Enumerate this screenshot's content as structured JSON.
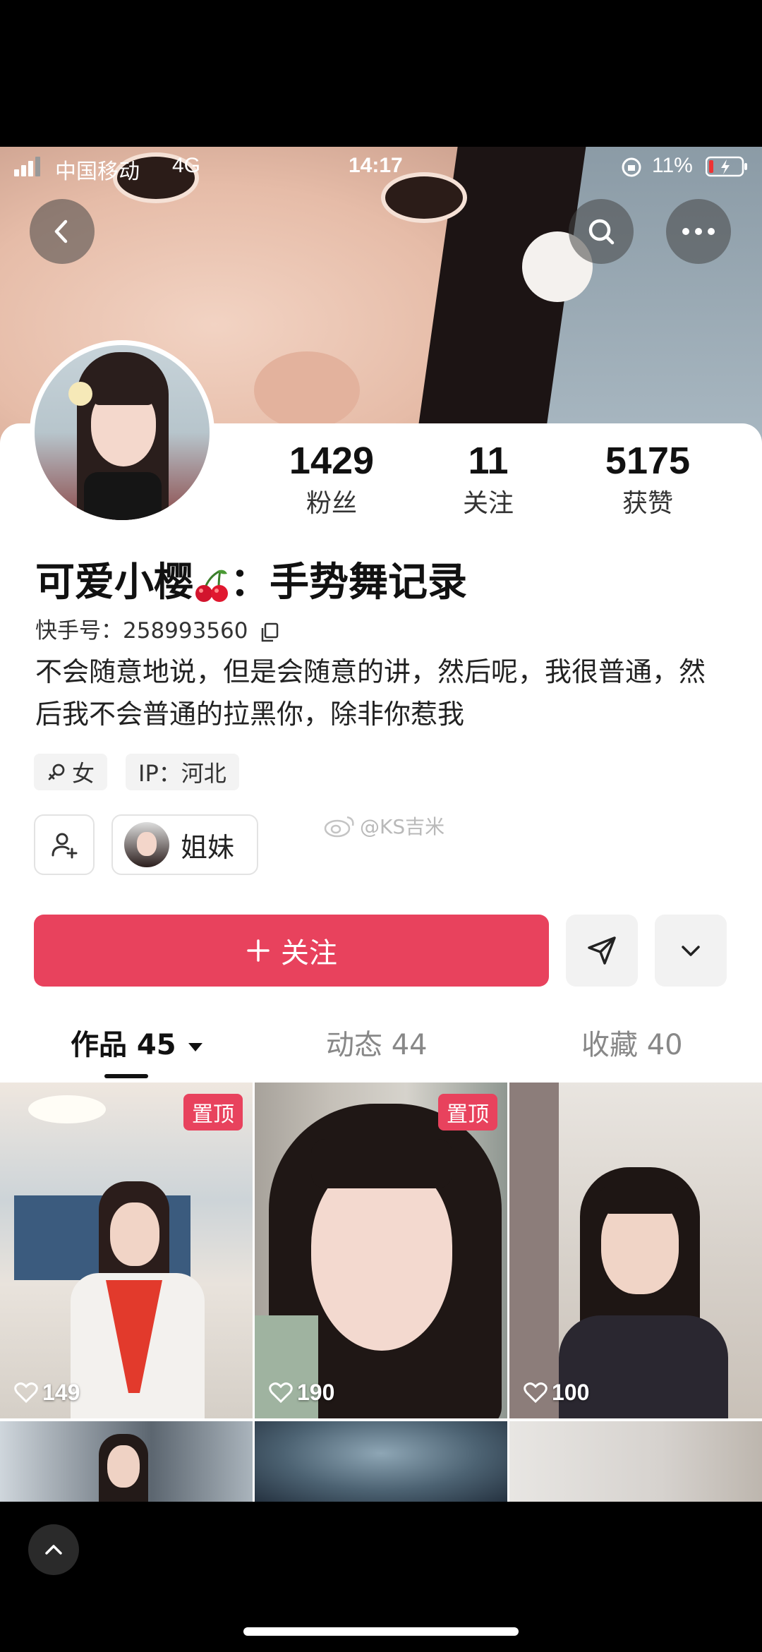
{
  "status_bar": {
    "carrier": "中国移动",
    "network": "4G",
    "time": "14:17",
    "battery": "11%"
  },
  "profile": {
    "followers_count": "1429",
    "followers_label": "粉丝",
    "following_count": "11",
    "following_label": "关注",
    "likes_count": "5175",
    "likes_label": "获赞",
    "nickname_prefix": "可爱小樱",
    "nickname_suffix": "：手势舞记录",
    "kuaishou_id": "快手号：258993560",
    "bio": "不会随意地说，但是会随意的讲，然后呢，我很普通，然后我不会普通的拉黑你，除非你惹我",
    "gender_tag": "女",
    "ip_tag": "IP：河北",
    "relation_label": "姐妹",
    "watermark": "@KS吉米"
  },
  "actions": {
    "follow_label": "关注"
  },
  "tabs": [
    {
      "label": "作品 45"
    },
    {
      "label": "动态 44"
    },
    {
      "label": "收藏 40"
    }
  ],
  "videos": [
    {
      "pin": "置顶",
      "likes": "149"
    },
    {
      "pin": "置顶",
      "likes": "190"
    },
    {
      "pin": "",
      "likes": "100"
    }
  ],
  "colors": {
    "accent": "#e8425d"
  }
}
